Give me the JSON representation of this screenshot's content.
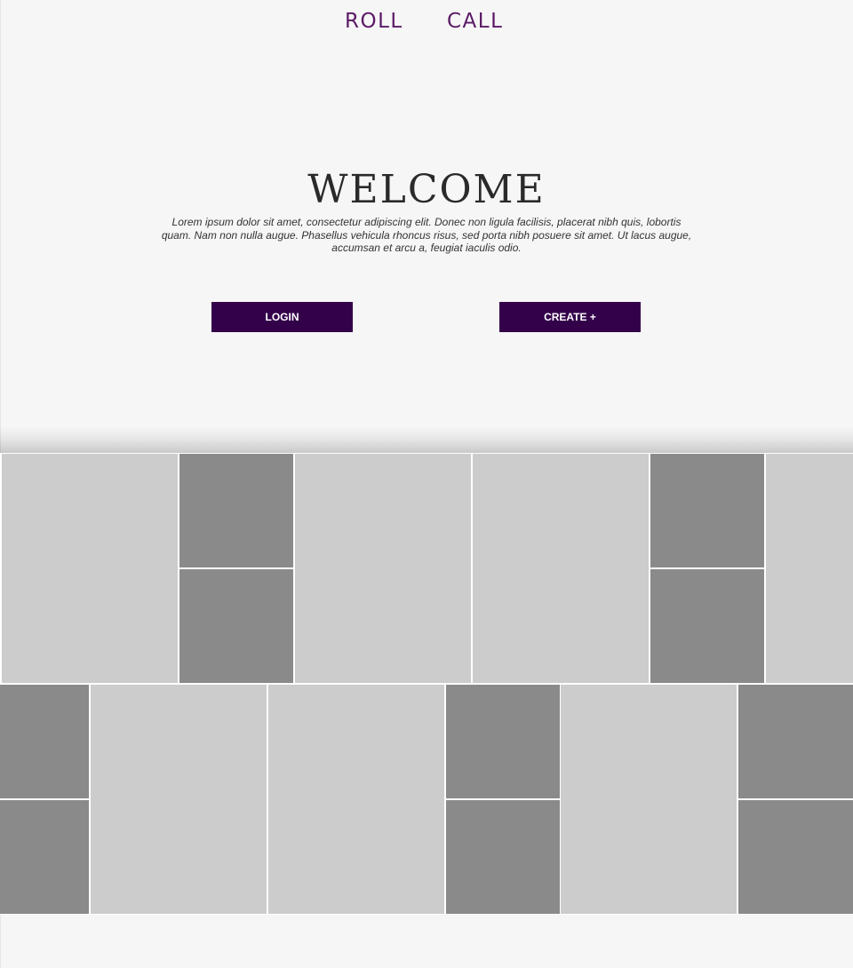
{
  "header": {
    "brand_part1": "ROLL",
    "brand_part2": "CALL",
    "brand_color": "#5a1a66"
  },
  "hero": {
    "title": "WELCOME",
    "text": "Lorem ipsum dolor sit amet, consectetur adipiscing elit. Donec non ligula facilisis, placerat nibh quis, lobortis quam. Nam non nulla augue. Phasellus vehicula rhoncus risus, sed porta nibh posuere sit amet. Ut lacus augue, accumsan et arcu a, feugiat iaculis odio."
  },
  "actions": {
    "login_label": "LOGIN",
    "create_label": "CREATE +",
    "button_color": "#33004a"
  },
  "gallery": {
    "tile_colors": {
      "light": "#cccccc",
      "dark": "#8a8a8a"
    }
  }
}
